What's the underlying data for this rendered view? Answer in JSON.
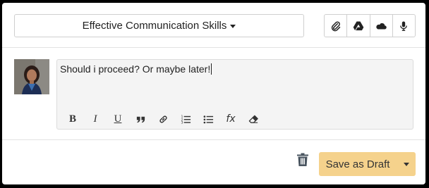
{
  "header": {
    "topic_label": "Effective Communication Skills",
    "attachments": [
      {
        "icon": "paperclip-icon"
      },
      {
        "icon": "google-drive-icon"
      },
      {
        "icon": "onedrive-cloud-icon"
      },
      {
        "icon": "microphone-icon"
      }
    ]
  },
  "editor": {
    "text": "Should i proceed? Or maybe later!",
    "toolbar": [
      {
        "name": "bold-button",
        "glyph": "B"
      },
      {
        "name": "italic-button",
        "glyph": "I"
      },
      {
        "name": "underline-button",
        "glyph": "U"
      },
      {
        "name": "quote-button",
        "glyph": "”"
      },
      {
        "name": "link-button",
        "glyph": ""
      },
      {
        "name": "ordered-list-button",
        "glyph": ""
      },
      {
        "name": "bullet-list-button",
        "glyph": ""
      },
      {
        "name": "formula-button",
        "glyph": "fx"
      },
      {
        "name": "clear-format-button",
        "glyph": ""
      }
    ]
  },
  "footer": {
    "save_label": "Save as Draft"
  },
  "colors": {
    "draft_button_bg": "#f5d28c",
    "trash_icon": "#4a5560"
  }
}
